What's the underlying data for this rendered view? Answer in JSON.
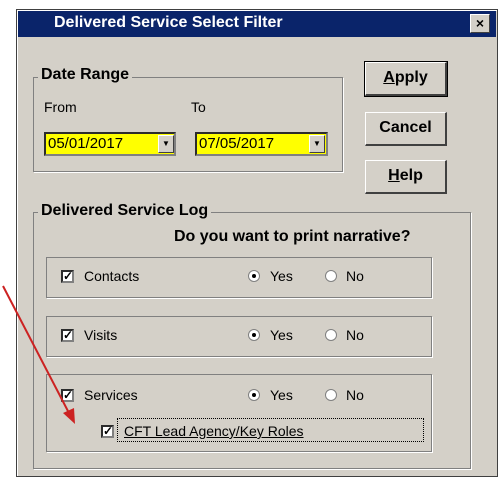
{
  "window": {
    "title": "Delivered Service Select Filter",
    "close_label": "×"
  },
  "date_range": {
    "legend": "Date Range",
    "from_label": "From",
    "to_label": "To",
    "from_value": "05/01/2017",
    "to_value": "07/05/2017"
  },
  "buttons": {
    "apply": {
      "first": "A",
      "rest": "pply"
    },
    "cancel": "Cancel",
    "help": {
      "first": "H",
      "rest": "elp"
    }
  },
  "log": {
    "legend": "Delivered Service Log",
    "question": "Do you want to print narrative?",
    "rows": [
      {
        "label": "Contacts",
        "checked": true,
        "yes": "Yes",
        "no": "No",
        "selected": "yes"
      },
      {
        "label": "Visits",
        "checked": true,
        "yes": "Yes",
        "no": "No",
        "selected": "yes"
      },
      {
        "label": "Services",
        "checked": true,
        "yes": "Yes",
        "no": "No",
        "selected": "yes"
      }
    ],
    "sub_option": {
      "label": "CFT Lead Agency/Key Roles",
      "checked": true
    }
  },
  "colors": {
    "title_bar": "#0a246a",
    "dialog_bg": "#d4d0c8",
    "date_field": "#ffff00",
    "arrow": "#cc2222"
  }
}
